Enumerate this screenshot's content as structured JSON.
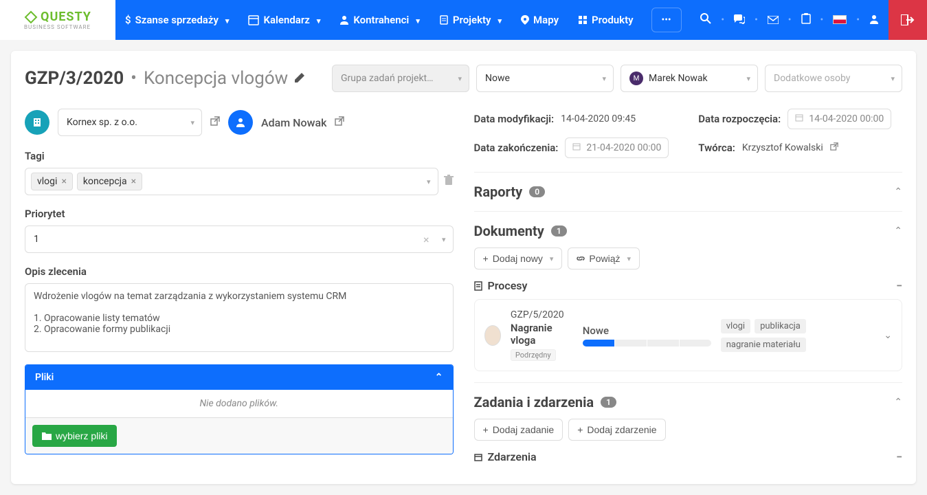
{
  "logo": {
    "main": "QUESTY",
    "sub": "BUSINESS SOFTWARE"
  },
  "nav": {
    "items": [
      {
        "icon": "$",
        "label": "Szanse sprzedaży"
      },
      {
        "icon": "calendar",
        "label": "Kalendarz"
      },
      {
        "icon": "person",
        "label": "Kontrahenci"
      },
      {
        "icon": "clipboard",
        "label": "Projekty"
      },
      {
        "icon": "pin",
        "label": "Mapy"
      },
      {
        "icon": "grid",
        "label": "Produkty"
      }
    ]
  },
  "header": {
    "code": "GZP/3/2020",
    "title": "Koncepcja vlogów",
    "group_placeholder": "Grupa zadań projekt…",
    "status": "Nowe",
    "assignee": "Marek Nowak",
    "extra_placeholder": "Dodatkowe osoby"
  },
  "left": {
    "company": "Kornex sp. z o.o.",
    "contact": "Adam Nowak",
    "tags_label": "Tagi",
    "tags": [
      "vlogi",
      "koncepcja"
    ],
    "priority_label": "Priorytet",
    "priority_value": "1",
    "desc_label": "Opis zlecenia",
    "desc_value": "Wdrożenie vlogów na temat zarządzania z wykorzystaniem systemu CRM\n\n1. Opracowanie listy tematów\n2. Opracowanie formy publikacji",
    "files_header": "Pliki",
    "files_empty": "Nie dodano plików.",
    "choose_files": "wybierz pliki"
  },
  "right": {
    "mod_label": "Data modyfikacji:",
    "mod_value": "14-04-2020 09:45",
    "start_label": "Data rozpoczęcia:",
    "start_value": "14-04-2020 00:00",
    "end_label": "Data zakończenia:",
    "end_value": "21-04-2020 00:00",
    "creator_label": "Twórca:",
    "creator_value": "Krzysztof Kowalski",
    "reports": {
      "title": "Raporty",
      "count": "0"
    },
    "documents": {
      "title": "Dokumenty",
      "count": "1",
      "add_new": "Dodaj nowy",
      "link": "Powiąż",
      "processes_title": "Procesy",
      "process": {
        "code": "GZP/5/2020",
        "name": "Nagranie vloga",
        "sub": "Podrzędny",
        "status": "Nowe",
        "tags": [
          "vlogi",
          "publikacja",
          "nagranie materiału"
        ]
      }
    },
    "tasks": {
      "title": "Zadania i zdarzenia",
      "count": "1",
      "add_task": "Dodaj zadanie",
      "add_event": "Dodaj zdarzenie",
      "events_title": "Zdarzenia"
    }
  }
}
